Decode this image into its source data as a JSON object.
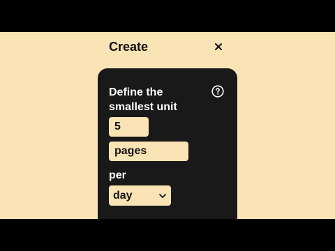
{
  "header": {
    "title": "Create",
    "close_icon": "close-icon"
  },
  "card": {
    "title": "Define the smallest unit",
    "help_icon": "help-circle-icon",
    "amount_value": "5",
    "unit_value": "pages",
    "per_label": "per",
    "period_value": "day",
    "period_icon": "chevron-down-icon"
  },
  "colors": {
    "background": "#fae3b4",
    "card": "#191919",
    "letterbox": "#000000"
  }
}
